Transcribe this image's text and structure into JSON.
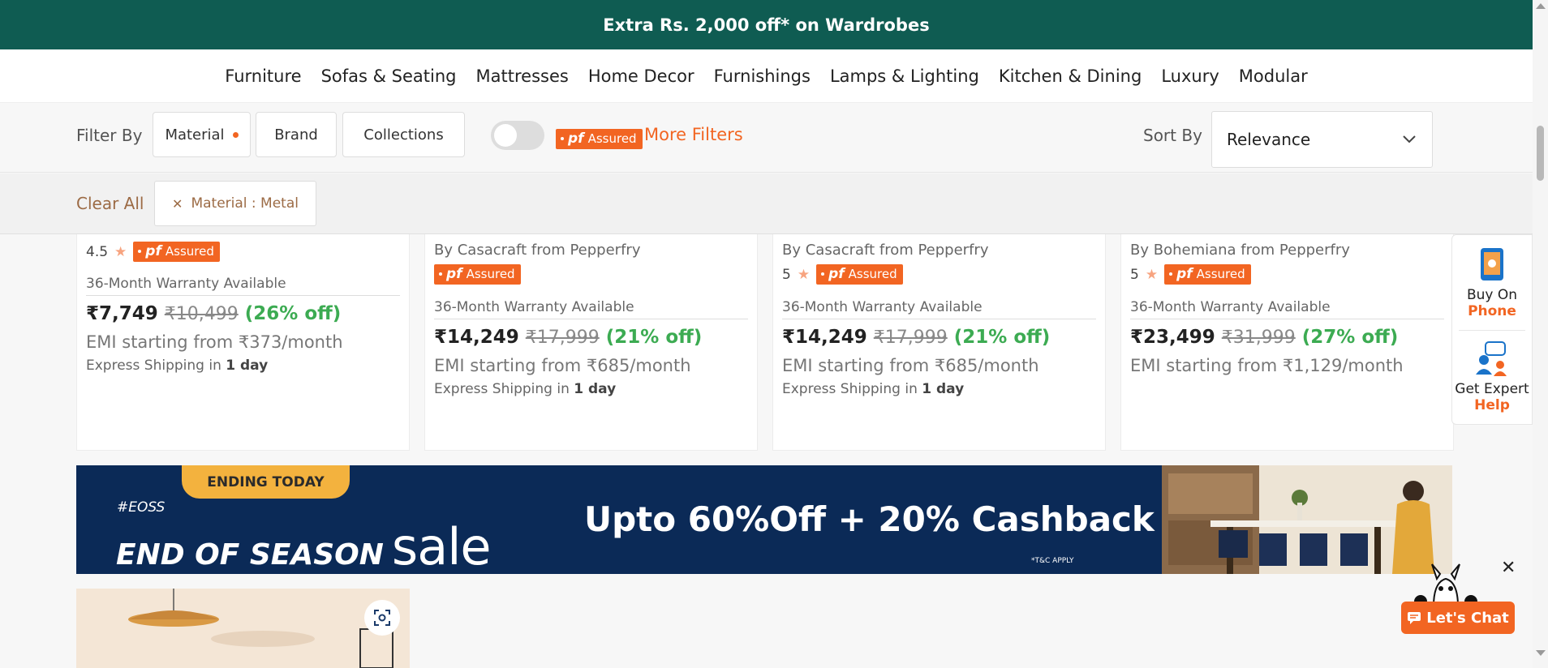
{
  "promo": {
    "text": "Extra Rs. 2,000 off* on Wardrobes"
  },
  "nav": {
    "items": [
      "Furniture",
      "Sofas & Seating",
      "Mattresses",
      "Home Decor",
      "Furnishings",
      "Lamps & Lighting",
      "Kitchen & Dining",
      "Luxury",
      "Modular"
    ]
  },
  "filters": {
    "label": "Filter By",
    "buttons": [
      "Material",
      "Brand",
      "Collections"
    ],
    "pf_assured": {
      "pf": "pf",
      "assured": "Assured"
    },
    "more_filters": "More Filters",
    "sort_label": "Sort By",
    "sort_value": "Relevance",
    "clear_all": "Clear All",
    "applied_chip": "Material : Metal"
  },
  "products": [
    {
      "brand": "",
      "rating": "4.5",
      "warranty": "36-Month Warranty Available",
      "price": "₹7,749",
      "mrp": "₹10,499",
      "off": "(26% off)",
      "emi": "EMI starting from ₹373/month",
      "ship_prefix": "Express Shipping in",
      "ship_days": "1 day"
    },
    {
      "brand": "By Casacraft from Pepperfry",
      "rating": "",
      "warranty": "36-Month Warranty Available",
      "price": "₹14,249",
      "mrp": "₹17,999",
      "off": "(21% off)",
      "emi": "EMI starting from ₹685/month",
      "ship_prefix": "Express Shipping in",
      "ship_days": "1 day"
    },
    {
      "brand": "By Casacraft from Pepperfry",
      "rating": "5",
      "warranty": "36-Month Warranty Available",
      "price": "₹14,249",
      "mrp": "₹17,999",
      "off": "(21% off)",
      "emi": "EMI starting from ₹685/month",
      "ship_prefix": "Express Shipping in",
      "ship_days": "1 day"
    },
    {
      "brand": "By Bohemiana from Pepperfry",
      "rating": "5",
      "warranty": "36-Month Warranty Available",
      "price": "₹23,499",
      "mrp": "₹31,999",
      "off": "(27% off)",
      "emi": "EMI starting from ₹1,129/month",
      "ship_prefix": "",
      "ship_days": ""
    }
  ],
  "banner": {
    "ending": "ENDING TODAY",
    "hashtag": "#EOSS",
    "title": "END OF SEASON",
    "sale": "sale",
    "offer": "Upto 60%Off + 20% Cashback",
    "tc": "*T&C APPLY"
  },
  "side_panel": {
    "buy_line1": "Buy On",
    "buy_line2": "Phone",
    "help_line1": "Get Expert",
    "help_line2": "Help"
  },
  "chat": {
    "label": "Let's Chat",
    "close": "✕"
  },
  "colors": {
    "brand_green": "#0f5c52",
    "accent_orange": "#f26522",
    "discount_green": "#3cab52",
    "banner_navy": "#0b2a57"
  }
}
